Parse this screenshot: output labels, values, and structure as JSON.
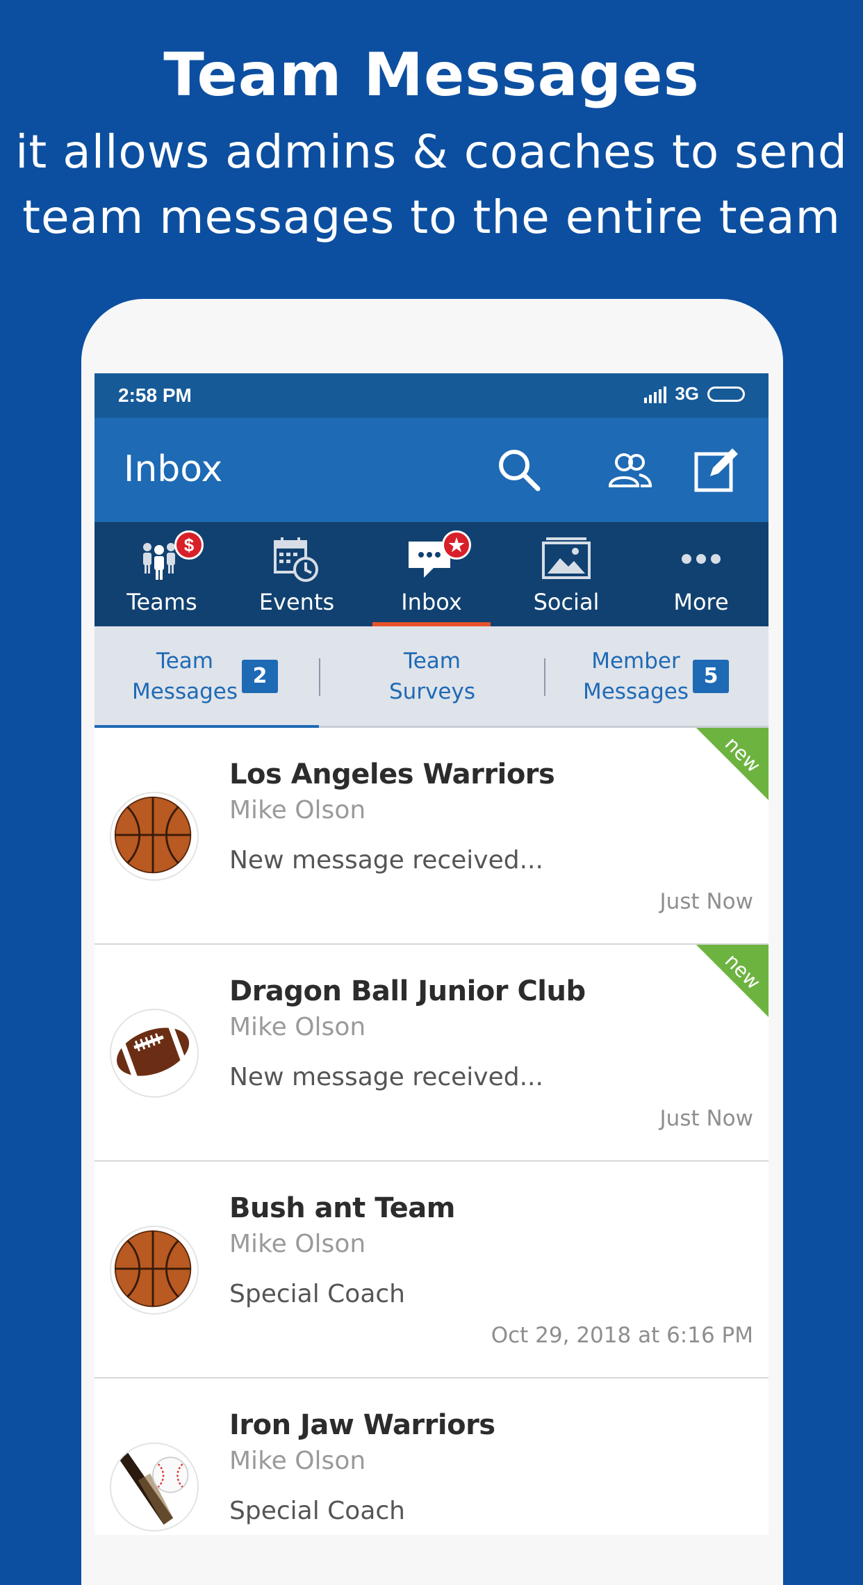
{
  "headline": {
    "title": "Team Messages",
    "line1": "it allows admins & coaches to send",
    "line2": "team messages to the entire team"
  },
  "status_bar": {
    "time": "2:58 PM",
    "network": "3G"
  },
  "app_bar": {
    "title": "Inbox"
  },
  "nav": {
    "items": [
      {
        "label": "Teams",
        "icon": "teams-icon",
        "badge": "$"
      },
      {
        "label": "Events",
        "icon": "calendar-clock-icon"
      },
      {
        "label": "Inbox",
        "icon": "chat-bubble-icon",
        "badge": "★",
        "active": true
      },
      {
        "label": "Social",
        "icon": "photo-icon"
      },
      {
        "label": "More",
        "icon": "more-dots-icon"
      }
    ]
  },
  "subtabs": {
    "team_messages": {
      "line1": "Team",
      "line2": "Messages",
      "count": "2"
    },
    "team_surveys": {
      "line1": "Team",
      "line2": "Surveys"
    },
    "member_messages": {
      "line1": "Member",
      "line2": "Messages",
      "count": "5"
    }
  },
  "messages": [
    {
      "title": "Los Angeles Warriors",
      "sender": "Mike Olson",
      "preview": "New message received...",
      "time": "Just Now",
      "ribbon": "new",
      "avatar": "basketball-icon"
    },
    {
      "title": "Dragon Ball Junior Club",
      "sender": "Mike Olson",
      "preview": "New message received...",
      "time": "Just Now",
      "ribbon": "new",
      "avatar": "football-icon"
    },
    {
      "title": "Bush ant Team",
      "sender": "Mike Olson",
      "preview": "Special Coach",
      "time": "Oct 29, 2018 at 6:16 PM",
      "avatar": "basketball-icon"
    },
    {
      "title": "Iron Jaw Warriors",
      "sender": "Mike Olson",
      "preview": "Special Coach",
      "time": "",
      "avatar": "baseball-icon"
    }
  ],
  "colors": {
    "background": "#0c4fa0",
    "status_bar": "#165a98",
    "app_bar": "#1e6ab5",
    "nav_bar": "#114170",
    "active_underline": "#e8532b",
    "badge": "#d8202a",
    "new_ribbon": "#6cb33f"
  }
}
